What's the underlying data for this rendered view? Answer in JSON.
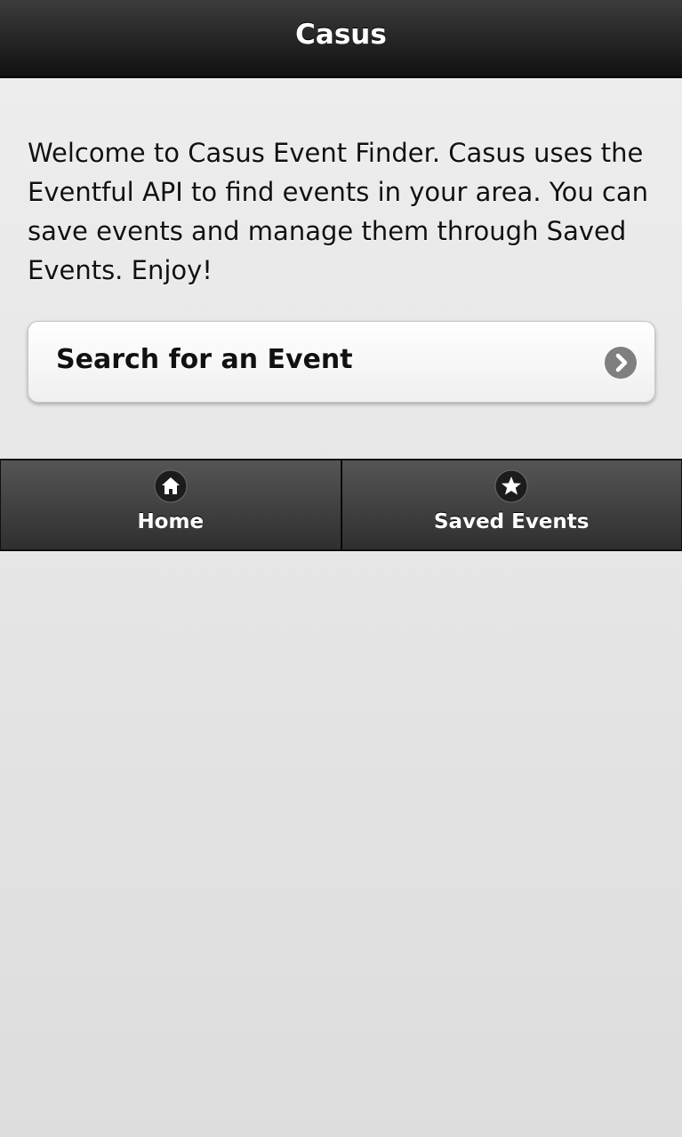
{
  "header": {
    "title": "Casus"
  },
  "main": {
    "intro_text": "Welcome to Casus Event Finder. Casus uses the Eventful API to find events in your area. You can save events and manage them through Saved Events. Enjoy!",
    "search_button_label": "Search for an Event",
    "search_button_icon": "chevron-right-icon"
  },
  "navbar": {
    "items": [
      {
        "label": "Home",
        "icon": "home-icon"
      },
      {
        "label": "Saved Events",
        "icon": "star-icon"
      }
    ]
  },
  "colors": {
    "header_bg": "#1a1a1a",
    "page_bg": "#e6e6e6",
    "button_bg": "#f7f7f7",
    "icon_disc": "#7f7f7f",
    "navbar_bg": "#3a3a3a"
  }
}
